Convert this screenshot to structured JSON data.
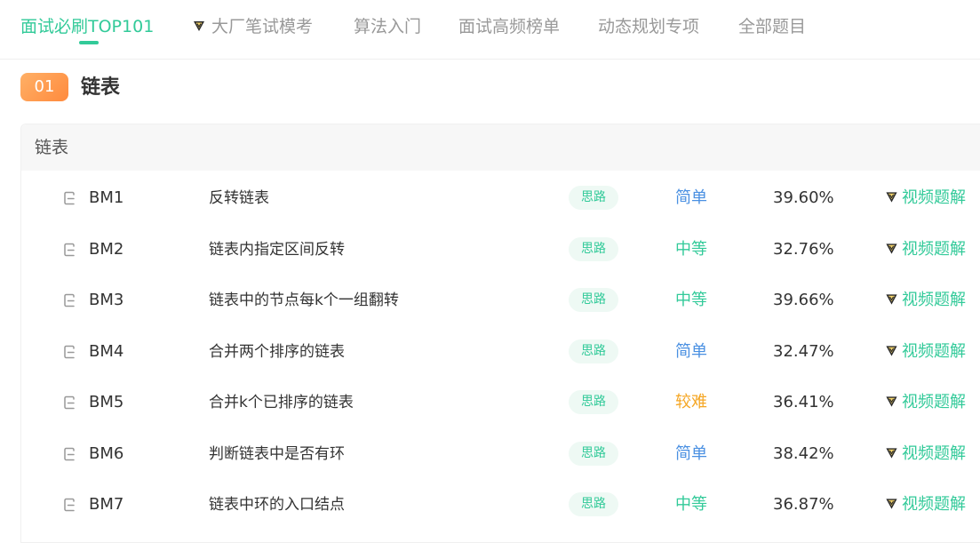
{
  "tabs": [
    {
      "label": "面试必刷TOP101",
      "active": true
    },
    {
      "label": "大厂笔试模考",
      "active": false,
      "icon": "vip-badge-icon"
    },
    {
      "label": "算法入门",
      "active": false
    },
    {
      "label": "面试高频榜单",
      "active": false
    },
    {
      "label": "动态规划专项",
      "active": false
    },
    {
      "label": "全部题目",
      "active": false
    }
  ],
  "section": {
    "number": "01",
    "title": "链表"
  },
  "card": {
    "title": "链表",
    "idea_label": "思路",
    "video_label": "视频题解"
  },
  "difficulty_colors": {
    "简单": "#4a90e2",
    "中等": "#32ca99",
    "较难": "#f5a623"
  },
  "questions": [
    {
      "id": "BM1",
      "title": "反转链表",
      "difficulty": "简单",
      "pass_rate": "39.60%"
    },
    {
      "id": "BM2",
      "title": "链表内指定区间反转",
      "difficulty": "中等",
      "pass_rate": "32.76%"
    },
    {
      "id": "BM3",
      "title": "链表中的节点每k个一组翻转",
      "difficulty": "中等",
      "pass_rate": "39.66%"
    },
    {
      "id": "BM4",
      "title": "合并两个排序的链表",
      "difficulty": "简单",
      "pass_rate": "32.47%"
    },
    {
      "id": "BM5",
      "title": "合并k个已排序的链表",
      "difficulty": "较难",
      "pass_rate": "36.41%"
    },
    {
      "id": "BM6",
      "title": "判断链表中是否有环",
      "difficulty": "简单",
      "pass_rate": "38.42%"
    },
    {
      "id": "BM7",
      "title": "链表中环的入口结点",
      "difficulty": "中等",
      "pass_rate": "36.87%"
    }
  ]
}
